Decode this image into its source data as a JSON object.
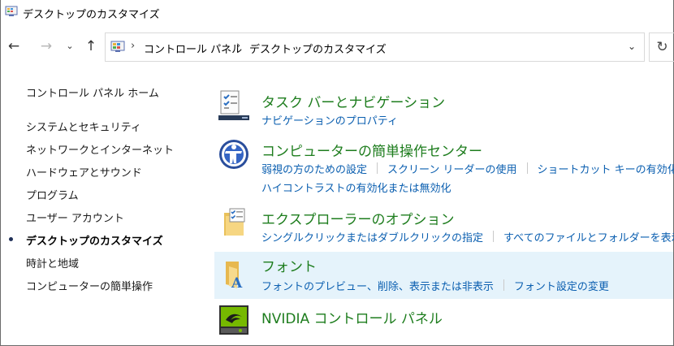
{
  "window": {
    "title": "デスクトップのカスタマイズ"
  },
  "navbar": {
    "back_icon": "←",
    "forward_icon": "→",
    "recent_icon": "⌄",
    "up_icon": "↑",
    "breadcrumb": [
      "コントロール パネル",
      "デスクトップのカスタマイズ"
    ],
    "breadcrumb_separator": "›",
    "dropdown_icon": "⌄",
    "refresh_icon": "↻"
  },
  "sidebar": {
    "home": "コントロール パネル ホーム",
    "items": [
      "システムとセキュリティ",
      "ネットワークとインターネット",
      "ハードウェアとサウンド",
      "プログラム",
      "ユーザー アカウント",
      "デスクトップのカスタマイズ",
      "時計と地域",
      "コンピューターの簡単操作"
    ],
    "active_index": 5
  },
  "categories": [
    {
      "title": "タスク バーとナビゲーション",
      "icon": "taskbar-icon",
      "links": [
        "ナビゲーションのプロパティ"
      ]
    },
    {
      "title": "コンピューターの簡単操作センター",
      "icon": "ease-of-access-icon",
      "links": [
        "弱視の方のための設定",
        "スクリーン リーダーの使用",
        "ショートカット キーの有効化"
      ],
      "links2": [
        "ハイコントラストの有効化または無効化"
      ]
    },
    {
      "title": "エクスプローラーのオプション",
      "icon": "folder-options-icon",
      "links": [
        "シングルクリックまたはダブルクリックの指定",
        "すべてのファイルとフォルダーを表示"
      ]
    },
    {
      "title": "フォント",
      "icon": "fonts-folder-icon",
      "links": [
        "フォントのプレビュー、削除、表示または非表示",
        "フォント設定の変更"
      ]
    },
    {
      "title": "NVIDIA コントロール パネル",
      "icon": "nvidia-icon",
      "links": []
    }
  ],
  "colors": {
    "title_green": "#1e7d1e",
    "link_blue": "#0b5fb0",
    "hover_bg": "#e5f3fb"
  }
}
